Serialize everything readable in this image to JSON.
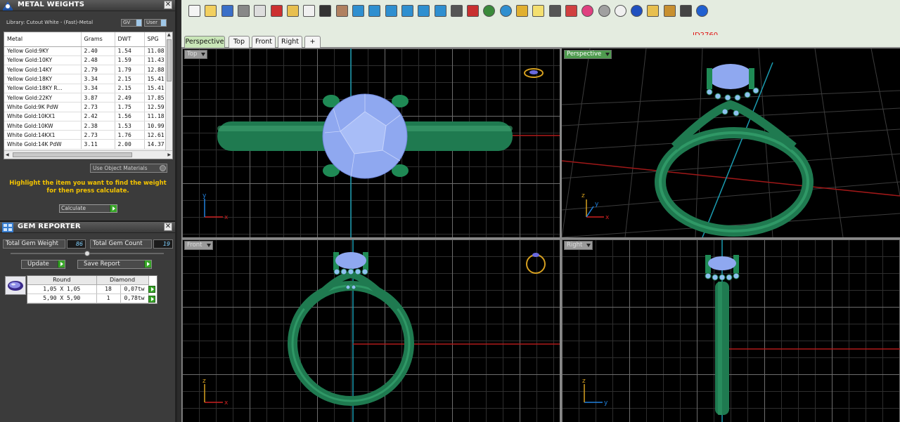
{
  "metal_weights": {
    "title": "METAL WEIGHTS",
    "library_label": "Library: Cutout White - (Fast)-Metal",
    "gv_label": "GV",
    "user_label": "User",
    "columns": [
      "Metal",
      "Grams",
      "DWT",
      "SPG"
    ],
    "rows": [
      [
        "Yellow Gold:9KY",
        "2.40",
        "1.54",
        "11.08"
      ],
      [
        "Yellow Gold:10KY",
        "2.48",
        "1.59",
        "11.43"
      ],
      [
        "Yellow Gold:14KY",
        "2.79",
        "1.79",
        "12.88"
      ],
      [
        "Yellow Gold:18KY",
        "3.34",
        "2.15",
        "15.41"
      ],
      [
        "Yellow Gold:18KY R...",
        "3.34",
        "2.15",
        "15.41"
      ],
      [
        "Yellow Gold:22KY",
        "3.87",
        "2.49",
        "17.85"
      ],
      [
        "White Gold:9K PdW",
        "2.73",
        "1.75",
        "12.59"
      ],
      [
        "White Gold:10KX1",
        "2.42",
        "1.56",
        "11.18"
      ],
      [
        "White Gold:10KW",
        "2.38",
        "1.53",
        "10.99"
      ],
      [
        "White Gold:14KX1",
        "2.73",
        "1.76",
        "12.61"
      ],
      [
        "White Gold:14K PdW",
        "3.11",
        "2.00",
        "14.37"
      ]
    ],
    "use_object_materials": "Use Object Materials",
    "instruction": "Highlight the item you want to find the weight for then press calculate.",
    "calculate_label": "Calculate"
  },
  "gem_reporter": {
    "title": "GEM REPORTER",
    "total_weight_label": "Total Gem Weight",
    "total_weight_value": "86",
    "total_count_label": "Total Gem Count",
    "total_count_value": "19",
    "update_label": "Update",
    "save_report_label": "Save Report",
    "columns": [
      "Round",
      "Diamond"
    ],
    "rows": [
      [
        "1,05 X 1,05",
        "18",
        "0,07tw"
      ],
      [
        "5,90 X 5,90",
        "1",
        "0,78tw"
      ]
    ]
  },
  "doc_id": "ID2760",
  "viewport_tabs": [
    "Perspective",
    "Top",
    "Front",
    "Right",
    "+"
  ],
  "viewports": {
    "top": {
      "label": "Top"
    },
    "perspective": {
      "label": "Perspective"
    },
    "front": {
      "label": "Front"
    },
    "right": {
      "label": "Right"
    }
  },
  "axis_labels": {
    "x": "x",
    "y": "y",
    "z": "z"
  },
  "colors": {
    "accent_green": "#4f9b4f",
    "ring_green": "#1f7a50",
    "gem_blue": "#8fa8f0",
    "highlight_text": "#f4c400",
    "doc_id_red": "#e01010"
  },
  "toolbar_icons": [
    "new-icon",
    "open-icon",
    "save-icon",
    "print-icon",
    "copy-icon",
    "cut-icon",
    "clipboard-icon",
    "paste-icon",
    "undo-icon",
    "pan-hand-icon",
    "move-icon",
    "zoom-in-icon",
    "zoom-window-icon",
    "zoom-extents-icon",
    "zoom-selected-icon",
    "rotate-view-icon",
    "four-viewports-icon",
    "car-icon",
    "eye-icon",
    "target-icon",
    "snap-icon",
    "light-bulb-icon",
    "lock-icon",
    "materials-icon",
    "color-wheel-icon",
    "sphere-gray-icon",
    "sphere-white-icon",
    "sphere-blue-icon",
    "pencil-icon",
    "gear-icon",
    "options-icon",
    "help-icon"
  ]
}
